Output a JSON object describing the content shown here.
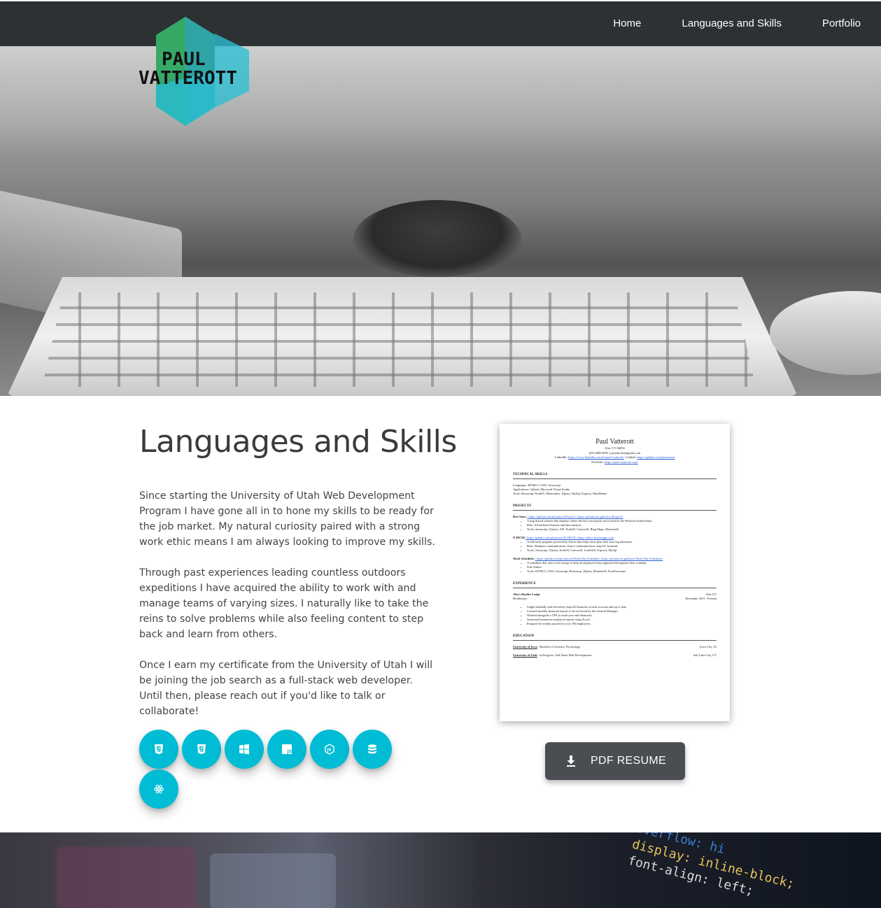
{
  "nav": {
    "items": [
      {
        "label": "Home"
      },
      {
        "label": "Languages and Skills"
      },
      {
        "label": "Portfolio"
      }
    ]
  },
  "logo": {
    "line1": "PAUL",
    "line2": "VATTEROTT",
    "colors": [
      "#2e9e6b",
      "#27b5c9",
      "#2ab4a5"
    ]
  },
  "section": {
    "title": "Languages and Skills",
    "paragraphs": [
      "Since starting the University of Utah Web Development Program I have gone all in to hone my skills to be ready for the job market. My natural curiosity paired with a strong work ethic means I am always looking to improve my skills.",
      "Through past experiences leading countless outdoors expeditions I have acquired the ability to work with and manage teams of varying sizes. I naturally like to take the reins to solve problems while also feeling content to step back and learn from others.",
      "Once I earn my certificate from the University of Utah I will be joining the job search as a full-stack web developer. Until then, please reach out if you'd like to talk or collaborate!"
    ]
  },
  "skills": {
    "color": "#00bcd4",
    "icons": [
      "html5-icon",
      "css3-icon",
      "windows-icon",
      "javascript-icon",
      "nodejs-icon",
      "database-icon",
      "react-icon"
    ]
  },
  "resume": {
    "name": "Paul Vatterott",
    "location": "Alta, UT 84092",
    "contact": "(651)308-4855 | pfvatterott@gmail.com",
    "linkedin_label": "LinkedIn:",
    "linkedin_url": "https://www.linkedin.com/in/paul-vatterott/",
    "github_label": "| Github:",
    "github_url": "https://github.com/pfvatterott",
    "portfolio_label": "Portfolio:",
    "portfolio_url": "https://paul-vatterott.com/",
    "technical_title": "TECHNICAL SKILLS",
    "languages": "Languages: HTML5, CSS3, Javascript",
    "applications": "Applications: Github, Microsoft Visual Studio",
    "tools": "Tools: Bootstrap, NodeJS, Materialize, JQuery, MySql, Express, Handlebars",
    "projects_title": "PROJECTS",
    "project1_name": "Best Snow",
    "project1_links": "| https://github.com/pfvatterott/Project1 | https://pfvatterott.github.io/Project1/",
    "project1_bullets": [
      "A map-based website that displays where the best snowpacks are located in the Western United States",
      "Role: All backend features and data analysis",
      "Tools: Javascript, JQuery, API, NodeJS, CanvasJS, Bing Maps, MomentJS"
    ],
    "project2_name": "N-DEVR",
    "project2_links": "| https://github.com/pfvatterott/N-DEVR | https://ndevr.herokuapp.com/",
    "project2_bullets": [
      "A full-stack program powered by Strava that helps users plan their next big adventure.",
      "Role: Database communication, Strava communication, map UI, backend.",
      "Tools: Javascript, JQuery, NodeJS, CanvasJS, LeafletJS, Express, MySql"
    ],
    "project3_name": "Work Scheduler",
    "project3_links": "| https://github.com/pfvatterott/Work-Day-Scheduler | https://pfvatterott.github.io/Work-Day-Scheduler/",
    "project3_bullets": [
      "A scheduler that uses local storage to help an employee keep organized throughout their workday",
      "Sole Author",
      "Tools: HTML5, CSS3, Javascript, Bootstrap, JQuery, MomentJS, FontAwesome"
    ],
    "experience_title": "EXPERIENCE",
    "job_place": "Alta's Rustler Lodge",
    "job_location": "Alta, UT",
    "job_title": "Bookkeeper",
    "job_dates": "December 2013 - Present",
    "job_bullets": [
      "Single handedly and effectively kept all financial records accurate and up to date.",
      "Created monthly financial reports to be reviewed by the General Manager.",
      "Worked alongside a CPA to audit year end financials.",
      "Generated numerous analytical reports using Excel.",
      "Prepared bi-weekly payroll for over 100 employees."
    ],
    "education_title": "EDUCATION",
    "edu1_school": "University of Iowa",
    "edu1_degree": "- Bachelor of Science, Psychology",
    "edu1_location": "Iowa City, IA",
    "edu2_school": "University of Utah",
    "edu2_degree": "- In Progress, Full Stack Web Development",
    "edu2_location": "Salt Lake City, UT"
  },
  "pdf_button": {
    "label": "PDF RESUME",
    "icon": "download-icon"
  },
  "bottom_banner": {
    "code_lines": [
      "overflow: hi",
      "display: inline-block;",
      "font-align: left;"
    ]
  }
}
